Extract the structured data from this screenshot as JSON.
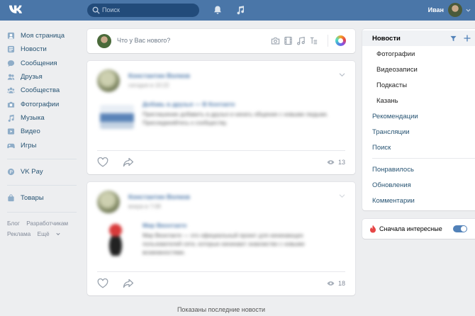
{
  "topbar": {
    "search_placeholder": "Поиск",
    "user_name": "Иван",
    "brand_color": "#4a76a8"
  },
  "leftnav": {
    "items": [
      {
        "label": "Моя страница",
        "icon": "home-icon"
      },
      {
        "label": "Новости",
        "icon": "news-icon"
      },
      {
        "label": "Сообщения",
        "icon": "messages-icon"
      },
      {
        "label": "Друзья",
        "icon": "friends-icon"
      },
      {
        "label": "Сообщества",
        "icon": "groups-icon"
      },
      {
        "label": "Фотографии",
        "icon": "camera-icon"
      },
      {
        "label": "Музыка",
        "icon": "music-icon"
      },
      {
        "label": "Видео",
        "icon": "video-icon"
      },
      {
        "label": "Игры",
        "icon": "games-icon"
      }
    ],
    "vkpay": "VK Pay",
    "goods": "Товары",
    "footer": {
      "blog": "Блог",
      "developers": "Разработчикам",
      "ads": "Реклама",
      "more": "Ещё"
    }
  },
  "composer": {
    "prompt": "Что у Вас нового?"
  },
  "posts": [
    {
      "author": "Константин Волков",
      "time": "сегодня в 10:22",
      "attach_title": "Добавь в друзья — В Контакте",
      "attach_text": "Приглашение добавить в друзья и начать общение с новыми людьми. Присоединяйтесь к сообществу.",
      "views": "13"
    },
    {
      "author": "Константин Волков",
      "time": "вчера в 7:08",
      "attach_title": "Мир Вконтакте",
      "attach_text": "Мир Вконтакте — это официальный проект для начинающих пользователей сети, которые начинают знакомство с новыми возможностями.",
      "views": "18"
    }
  ],
  "feed_footer": "Показаны последние новости",
  "rightpanel": {
    "news": "Новости",
    "photos": "Фотографии",
    "videos": "Видеозаписи",
    "podcasts": "Подкасты",
    "kazan": "Казань",
    "recommendations": "Рекомендации",
    "broadcasts": "Трансляции",
    "search": "Поиск",
    "liked": "Понравилось",
    "updates": "Обновления",
    "comments": "Комментарии"
  },
  "toggle": {
    "label": "Сначала интересные",
    "enabled": true
  }
}
